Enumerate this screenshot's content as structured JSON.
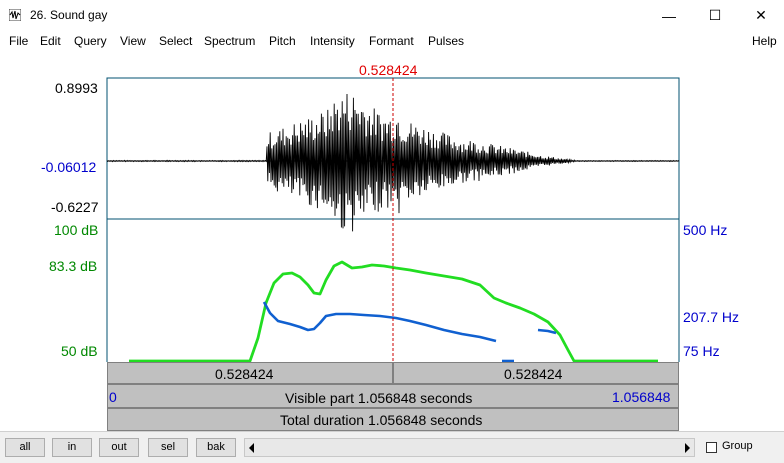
{
  "window": {
    "title": "26. Sound gay",
    "minimize": "—",
    "maximize": "☐",
    "close": "✕"
  },
  "menu": [
    "File",
    "Edit",
    "Query",
    "View",
    "Select",
    "Spectrum",
    "Pitch",
    "Intensity",
    "Formant",
    "Pulses",
    "Help"
  ],
  "cursor_time": "0.528424",
  "waveform": {
    "max_label": "0.8993",
    "zero_label": "-0.06012",
    "min_label": "-0.6227"
  },
  "intensity": {
    "top_label": "100 dB",
    "mid_label": "83.3 dB",
    "bottom_label": "50 dB"
  },
  "pitch": {
    "top_label": "500 Hz",
    "mid_label": "207.7 Hz",
    "bottom_label": "75 Hz"
  },
  "timebar": {
    "left_segment": "0.528424",
    "right_segment": "0.528424",
    "visible_part": "Visible part 1.056848 seconds",
    "start": "0",
    "end": "1.056848",
    "total_duration": "Total duration 1.056848 seconds"
  },
  "buttons": {
    "all": "all",
    "in": "in",
    "out": "out",
    "sel": "sel",
    "bak": "bak"
  },
  "group_label": "Group",
  "colors": {
    "intensity_curve": "#22dd22",
    "pitch_curve": "#1060d0",
    "cursor": "#cc0000",
    "axis_blue": "#0000cc",
    "axis_green": "#008800"
  }
}
